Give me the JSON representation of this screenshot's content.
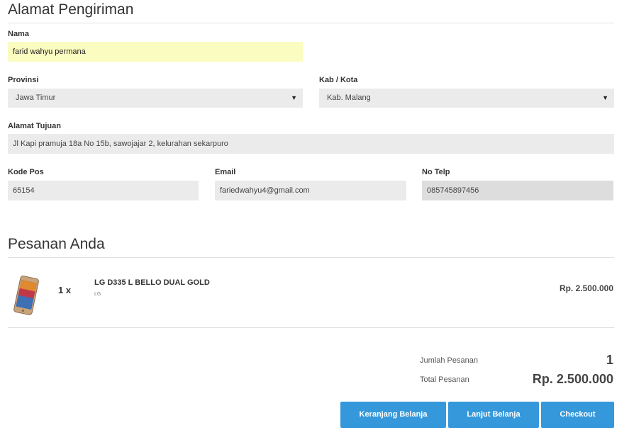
{
  "shipping": {
    "title": "Alamat Pengiriman",
    "name_label": "Nama",
    "name_value": "farid wahyu permana",
    "province_label": "Provinsi",
    "province_value": "Jawa Timur",
    "city_label": "Kab / Kota",
    "city_value": "Kab. Malang",
    "address_label": "Alamat Tujuan",
    "address_value": "Jl Kapi pramuja 18a No 15b, sawojajar 2, kelurahan sekarpuro",
    "postal_label": "Kode Pos",
    "postal_value": "65154",
    "email_label": "Email",
    "email_value": "fariedwahyu4@gmail.com",
    "phone_label": "No Telp",
    "phone_value": "085745897456"
  },
  "order": {
    "title": "Pesanan Anda",
    "items": [
      {
        "icon": "smartphone-thumbnail",
        "quantity": "1 x",
        "name": "LG D335 L BELLO DUAL GOLD",
        "brand": "LG",
        "price": "Rp. 2.500.000"
      }
    ],
    "summary": {
      "count_label": "Jumlah Pesanan",
      "count_value": "1",
      "total_label": "Total Pesanan",
      "total_value": "Rp. 2.500.000"
    }
  },
  "actions": {
    "cart_label": "Keranjang Belanja",
    "continue_label": "Lanjut Belanja",
    "checkout_label": "Checkout"
  },
  "colors": {
    "accent": "#3498db",
    "highlight_field": "#fafcc0",
    "field_bg": "#ebebeb"
  }
}
